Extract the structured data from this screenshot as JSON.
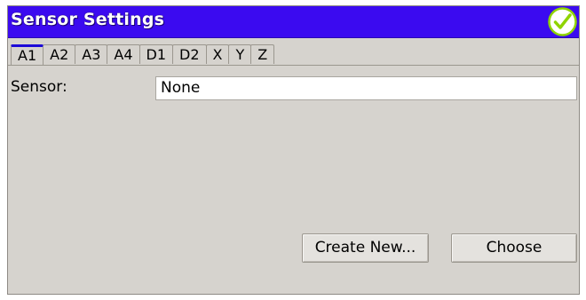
{
  "window": {
    "title": "Sensor Settings",
    "ok_icon": "checkmark-circle-icon"
  },
  "tabs": [
    {
      "label": "A1",
      "active": true
    },
    {
      "label": "A2",
      "active": false
    },
    {
      "label": "A3",
      "active": false
    },
    {
      "label": "A4",
      "active": false
    },
    {
      "label": "D1",
      "active": false
    },
    {
      "label": "D2",
      "active": false
    },
    {
      "label": "X",
      "active": false
    },
    {
      "label": "Y",
      "active": false
    },
    {
      "label": "Z",
      "active": false
    }
  ],
  "sensor": {
    "label": "Sensor:",
    "value": "None"
  },
  "buttons": {
    "create_new": "Create New...",
    "choose": "Choose"
  },
  "colors": {
    "titlebar": "#3b0af0",
    "window_bg": "#d6d3ce",
    "ok_green": "#8fd400"
  }
}
